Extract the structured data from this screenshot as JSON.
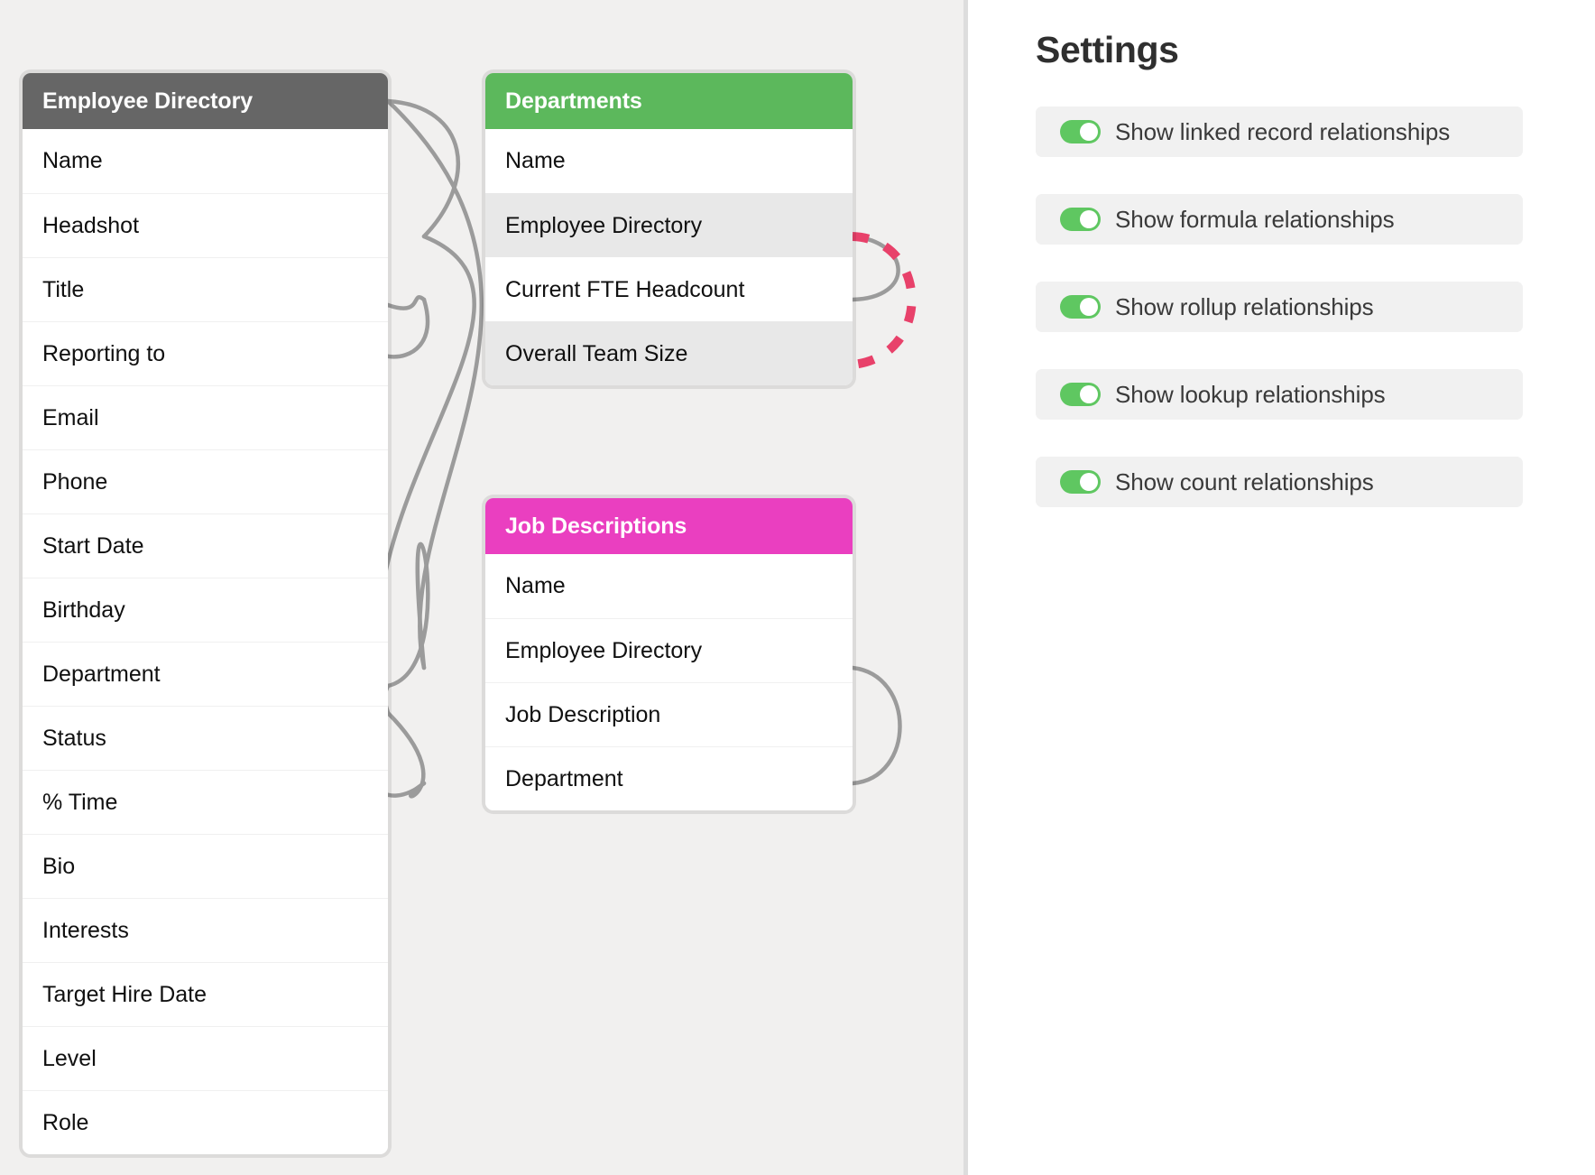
{
  "canvas": {
    "background_color": "#f1f0ef",
    "tables": [
      {
        "id": "employee-directory",
        "title": "Employee Directory",
        "header_color": "#666666",
        "fields": [
          {
            "label": "Name",
            "shaded": false
          },
          {
            "label": "Headshot",
            "shaded": false
          },
          {
            "label": "Title",
            "shaded": false
          },
          {
            "label": "Reporting to",
            "shaded": false
          },
          {
            "label": "Email",
            "shaded": false
          },
          {
            "label": "Phone",
            "shaded": false
          },
          {
            "label": "Start Date",
            "shaded": false
          },
          {
            "label": "Birthday",
            "shaded": false
          },
          {
            "label": "Department",
            "shaded": false
          },
          {
            "label": "Status",
            "shaded": false
          },
          {
            "label": "% Time",
            "shaded": false
          },
          {
            "label": "Bio",
            "shaded": false
          },
          {
            "label": "Interests",
            "shaded": false
          },
          {
            "label": "Target Hire Date",
            "shaded": false
          },
          {
            "label": "Level",
            "shaded": false
          },
          {
            "label": "Role",
            "shaded": false
          }
        ]
      },
      {
        "id": "departments",
        "title": "Departments",
        "header_color": "#5cb85c",
        "fields": [
          {
            "label": "Name",
            "shaded": false
          },
          {
            "label": "Employee Directory",
            "shaded": true
          },
          {
            "label": "Current FTE Headcount",
            "shaded": false
          },
          {
            "label": "Overall Team Size",
            "shaded": true
          }
        ]
      },
      {
        "id": "job-descriptions",
        "title": "Job Descriptions",
        "header_color": "#ea3fc0",
        "fields": [
          {
            "label": "Name",
            "shaded": false
          },
          {
            "label": "Employee Directory",
            "shaded": false
          },
          {
            "label": "Job Description",
            "shaded": false
          },
          {
            "label": "Department",
            "shaded": false
          }
        ]
      }
    ],
    "connectors": {
      "link_color": "#9b9b9b",
      "highlight_color": "#e8416a",
      "highlight_style": "dashed"
    }
  },
  "settings": {
    "title": "Settings",
    "toggle_on_color": "#5fc761",
    "row_background": "#f1f1f1",
    "options": [
      {
        "label": "Show linked record relationships",
        "enabled": true,
        "state": "on"
      },
      {
        "label": "Show formula relationships",
        "enabled": true,
        "state": "on"
      },
      {
        "label": "Show rollup relationships",
        "enabled": true,
        "state": "on"
      },
      {
        "label": "Show lookup relationships",
        "enabled": true,
        "state": "on"
      },
      {
        "label": "Show count relationships",
        "enabled": true,
        "state": "on"
      }
    ]
  }
}
